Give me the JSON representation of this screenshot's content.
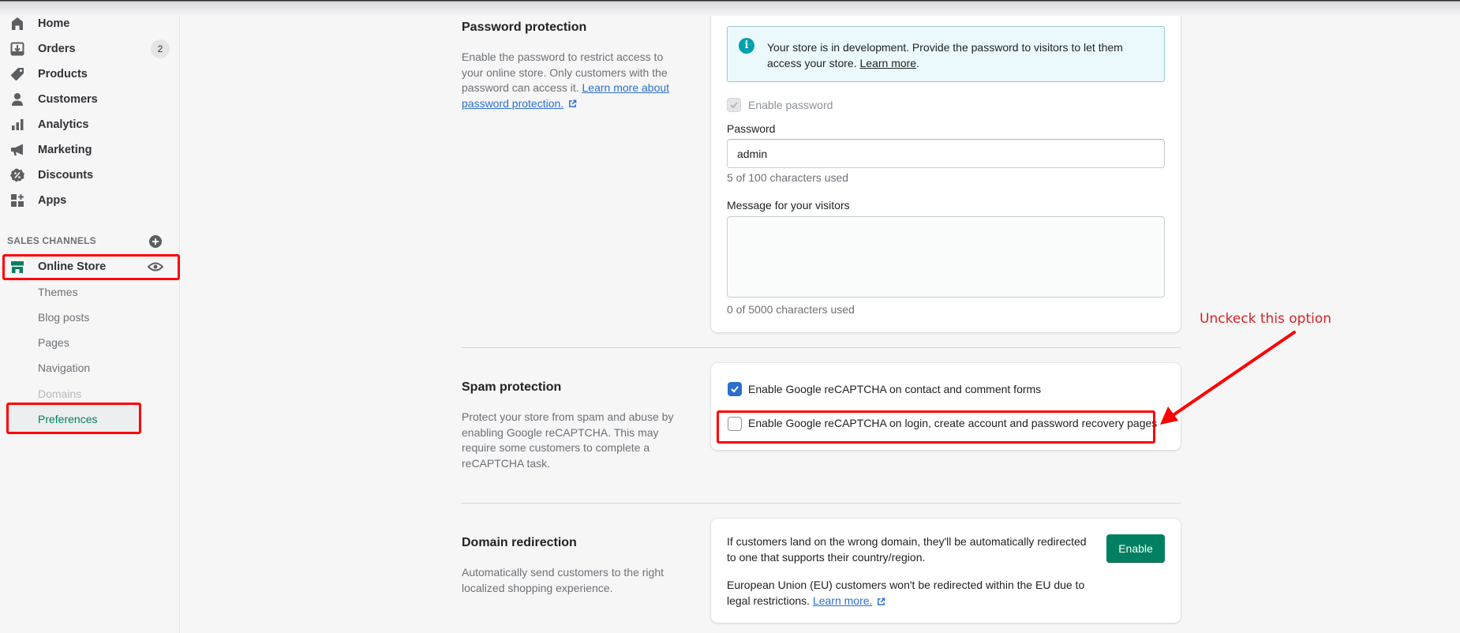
{
  "sidebar": {
    "nav": [
      {
        "label": "Home",
        "icon": "home-icon"
      },
      {
        "label": "Orders",
        "icon": "orders-icon",
        "badge": "2"
      },
      {
        "label": "Products",
        "icon": "tag-icon"
      },
      {
        "label": "Customers",
        "icon": "person-icon"
      },
      {
        "label": "Analytics",
        "icon": "bar-chart-icon"
      },
      {
        "label": "Marketing",
        "icon": "megaphone-icon"
      },
      {
        "label": "Discounts",
        "icon": "discount-icon"
      },
      {
        "label": "Apps",
        "icon": "apps-icon"
      }
    ],
    "sales_channels_header": "SALES CHANNELS",
    "online_store": {
      "label": "Online Store",
      "icon": "store-icon"
    },
    "sub_items": [
      {
        "label": "Themes",
        "state": "normal"
      },
      {
        "label": "Blog posts",
        "state": "normal"
      },
      {
        "label": "Pages",
        "state": "normal"
      },
      {
        "label": "Navigation",
        "state": "normal"
      },
      {
        "label": "Domains",
        "state": "disabled"
      },
      {
        "label": "Preferences",
        "state": "active"
      }
    ]
  },
  "password_section": {
    "title": "Password protection",
    "description": "Enable the password to restrict access to your online store. Only customers with the password can access it.",
    "learn_more": "Learn more about password protection.",
    "banner": {
      "text": "Your store is in development. Provide the password to visitors to let them access your store.",
      "link": "Learn more",
      "icon": "info-icon"
    },
    "enable_password": {
      "label": "Enable password",
      "checked": true,
      "disabled": true
    },
    "password_label": "Password",
    "password_value": "admin",
    "password_help": "5 of 100 characters used",
    "message_label": "Message for your visitors",
    "message_value": "",
    "message_help": "0 of 5000 characters used"
  },
  "spam_section": {
    "title": "Spam protection",
    "description": "Protect your store from spam and abuse by enabling Google reCAPTCHA. This may require some customers to complete a reCAPTCHA task.",
    "options": [
      {
        "label": "Enable Google reCAPTCHA on contact and comment forms",
        "checked": true
      },
      {
        "label": "Enable Google reCAPTCHA on login, create account and password recovery pages",
        "checked": false
      }
    ]
  },
  "redirect_section": {
    "title": "Domain redirection",
    "description": "Automatically send customers to the right localized shopping experience.",
    "text1": "If customers land on the wrong domain, they'll be automatically redirected to one that supports their country/region.",
    "text2": "European Union (EU) customers won't be redirected within the EU due to legal restrictions.",
    "learn_more": "Learn more.",
    "button": "Enable"
  },
  "annotation": {
    "text": "Unckeck this option",
    "color": "#ff0000"
  },
  "colors": {
    "accent_green": "#008060",
    "checkbox_blue": "#2c6ecb",
    "link_blue": "#2c6ecb"
  }
}
